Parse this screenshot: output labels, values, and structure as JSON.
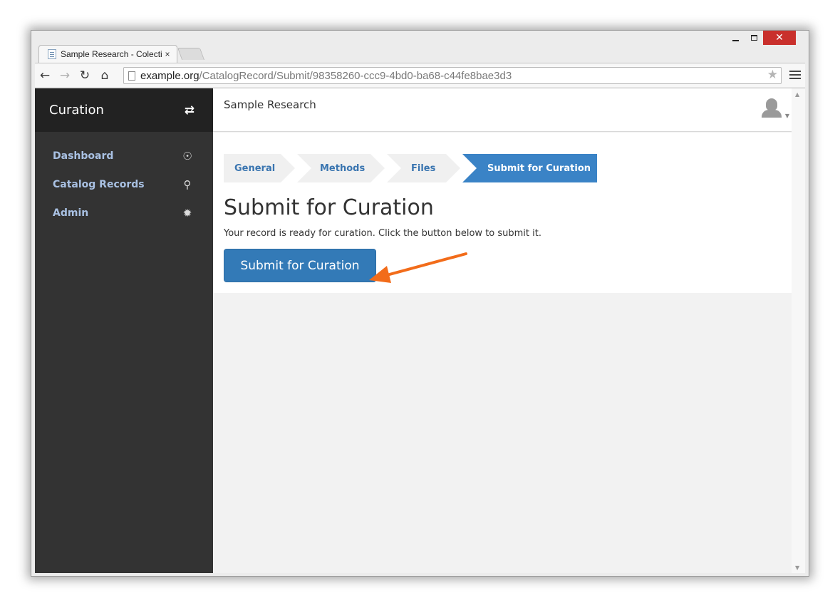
{
  "browser": {
    "tab_title": "Sample Research - Colecti",
    "tab_close": "×",
    "window_close": "✕",
    "url_host": "example.org",
    "url_path": "/CatalogRecord/Submit/98358260-ccc9-4bd0-ba68-c44fe8bae3d3",
    "back": "←",
    "forward": "→",
    "reload": "↻",
    "home": "⌂",
    "star": "★"
  },
  "sidebar": {
    "brand": "Curation",
    "toggle_icon": "⇄",
    "items": [
      {
        "label": "Dashboard",
        "icon": "☉"
      },
      {
        "label": "Catalog Records",
        "icon": "⚲"
      },
      {
        "label": "Admin",
        "icon": "✹"
      }
    ]
  },
  "header": {
    "org_name": "Sample Research",
    "avatar_caret": "▼"
  },
  "steps": [
    {
      "label": "General"
    },
    {
      "label": "Methods"
    },
    {
      "label": "Files"
    },
    {
      "label": "Submit for Curation"
    }
  ],
  "main": {
    "title": "Submit for Curation",
    "description": "Your record is ready for curation. Click the button below to submit it.",
    "submit_label": "Submit for Curation"
  },
  "colors": {
    "sidebar": "#333333",
    "brand_bar": "#222222",
    "primary": "#337ab7",
    "annotation_arrow": "#f26c1a"
  }
}
